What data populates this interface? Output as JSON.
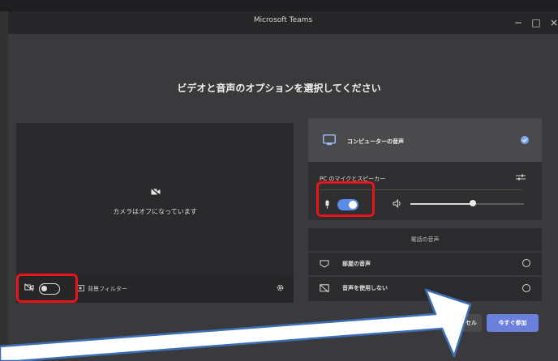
{
  "window": {
    "title": "Microsoft Teams",
    "minimize": "−",
    "maximize": "□",
    "close": "×"
  },
  "heading": "ビデオと音声のオプションを選択してください",
  "video": {
    "camera_off_text": "カメラはオフになっています",
    "background_filter_label": "背景フィルター",
    "camera_enabled": false
  },
  "audio": {
    "computer_audio_label": "コンピューターの音声",
    "device_label": "PC のマイクとスピーカー",
    "mic_enabled": true,
    "volume_level": 0.55,
    "phone_audio_label": "電話の音声",
    "room_audio_label": "部屋の音声",
    "no_audio_label": "音声を使用しない"
  },
  "buttons": {
    "cancel": "セル",
    "join_now": "今すぐ参加"
  },
  "colors": {
    "highlight": "#e8141c",
    "accent": "#5b8de8",
    "arrow_fill": "#ffffff",
    "arrow_stroke": "#3c6fb5"
  }
}
